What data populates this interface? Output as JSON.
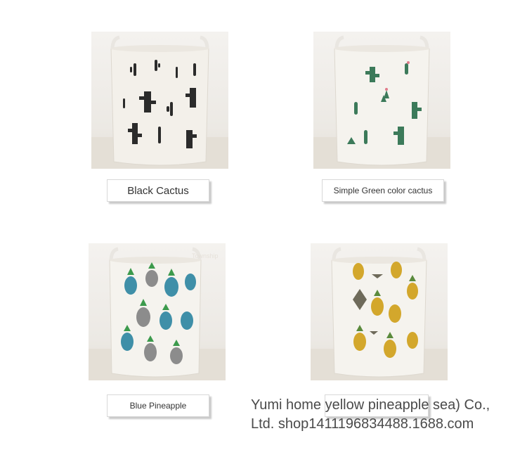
{
  "products": [
    {
      "name": "Black Cactus",
      "image_alt": "black-cactus-laundry-basket"
    },
    {
      "name": "Simple Green color cactus",
      "image_alt": "green-cactus-laundry-basket"
    },
    {
      "name": "Blue Pineapple",
      "image_alt": "blue-pineapple-laundry-basket"
    },
    {
      "name": "",
      "image_alt": "yellow-pineapple-laundry-basket"
    }
  ],
  "watermark": "Township",
  "footer": {
    "line1": "Yumi home yellow pineapple sea) Co.,",
    "line2": "Ltd. shop1411196834488.1688.com"
  },
  "colors": {
    "black_cactus": "#2b2b2b",
    "green_cactus": "#3c7a5a",
    "blue_pineapple": "#3f8fa8",
    "gray_pineapple": "#8c8c8c",
    "yellow_pineapple": "#d3a72c"
  }
}
